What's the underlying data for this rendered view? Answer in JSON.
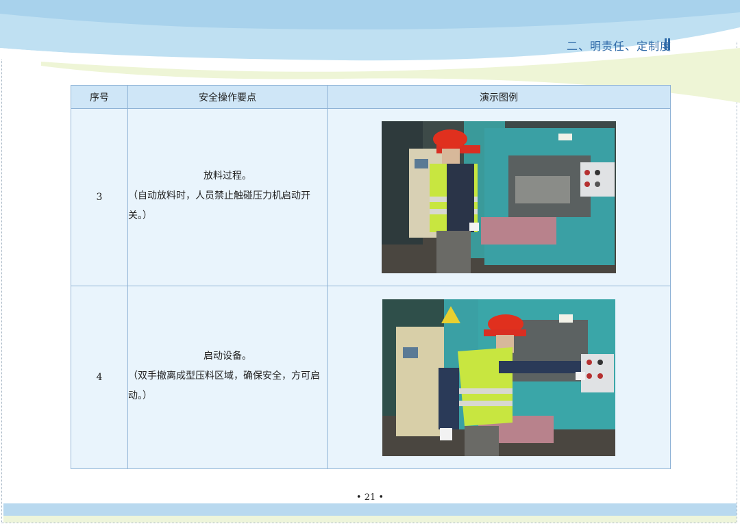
{
  "header": {
    "section_title": "二、明责任、定制度"
  },
  "table": {
    "columns": [
      "序号",
      "安全操作要点",
      "演示图例"
    ],
    "rows": [
      {
        "num": "3",
        "title": "放料过程。",
        "body": "（自动放料时，人员禁止触碰压力机启动开关。）",
        "image": "worker-beside-press-photo"
      },
      {
        "num": "4",
        "title": "启动设备。",
        "body": "（双手撤离成型压料区域，确保安全，方可启动。）",
        "image": "worker-pressing-start-button-photo"
      }
    ]
  },
  "footer": {
    "page_number": "• 21 •"
  },
  "colors": {
    "header_blue": "#2f6aa8",
    "table_header": "#cfe6f7",
    "table_cell": "#e9f4fc",
    "border": "#8fb3d6"
  }
}
